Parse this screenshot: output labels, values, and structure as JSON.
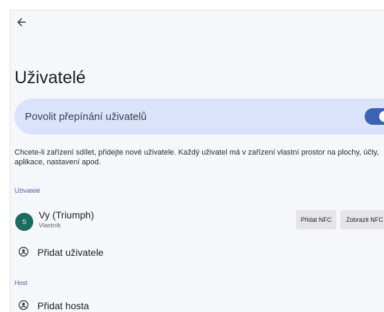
{
  "page": {
    "title": "Uživatelé"
  },
  "toggle": {
    "label": "Povolit přepínání uživatelů",
    "enabled": true
  },
  "description": "Chcete-li zařízení sdílet, přidejte nové uživatele. Každý uživatel má v zařízení vlastní prostor na plochy, účty, aplikace, nastavení apod.",
  "users_section": {
    "header": "Uživatelé",
    "current_user": {
      "avatar_letter": "S",
      "name": "Vy (Triumph)",
      "role": "Vlastník",
      "buttons": [
        "Přidat NFC",
        "Zobrazit NFC"
      ]
    },
    "add_user_label": "Přidat uživatele"
  },
  "guest_section": {
    "header": "Host",
    "add_guest_label": "Přidat hosta"
  },
  "colors": {
    "accent": "#3c61b5",
    "card": "#dbe3fb",
    "avatar": "#1b6b5f"
  }
}
